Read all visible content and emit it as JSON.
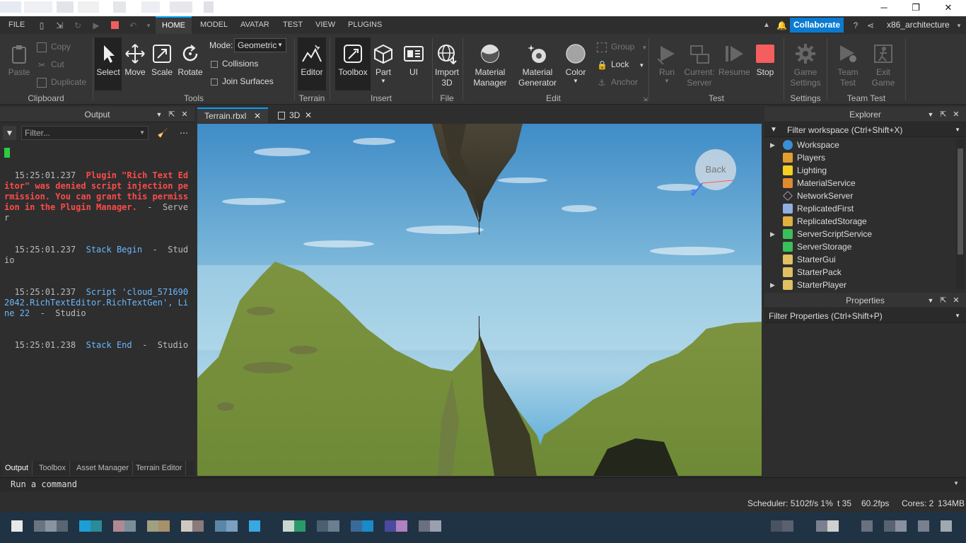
{
  "window": {
    "controls": {
      "minimize": "─",
      "maximize": "❐",
      "close": "✕"
    }
  },
  "menubar": {
    "file": "FILE",
    "tabs": [
      "HOME",
      "MODEL",
      "AVATAR",
      "TEST",
      "VIEW",
      "PLUGINS"
    ],
    "active_tab": "HOME",
    "collaborate": "Collaborate",
    "username": "x86_architecture"
  },
  "ribbon": {
    "clipboard": {
      "paste": "Paste",
      "copy": "Copy",
      "cut": "Cut",
      "duplicate": "Duplicate",
      "group": "Clipboard"
    },
    "tools": {
      "select": "Select",
      "move": "Move",
      "scale": "Scale",
      "rotate": "Rotate",
      "mode_label": "Mode:",
      "mode_value": "Geometric",
      "collisions": "Collisions",
      "join_surfaces": "Join Surfaces",
      "group": "Tools"
    },
    "terrain": {
      "editor": "Editor",
      "group": "Terrain"
    },
    "insert": {
      "toolbox": "Toolbox",
      "part": "Part",
      "ui": "UI",
      "group": "Insert"
    },
    "file": {
      "import3d_1": "Import",
      "import3d_2": "3D",
      "group": "File"
    },
    "edit": {
      "material_manager_1": "Material",
      "material_manager_2": "Manager",
      "material_generator_1": "Material",
      "material_generator_2": "Generator",
      "color": "Color",
      "group_btn": "Group",
      "lock": "Lock",
      "anchor": "Anchor",
      "group": "Edit"
    },
    "test": {
      "run": "Run",
      "current_server_1": "Current:",
      "current_server_2": "Server",
      "resume": "Resume",
      "stop": "Stop",
      "group": "Test"
    },
    "settings": {
      "game_settings_1": "Game",
      "game_settings_2": "Settings",
      "group": "Settings"
    },
    "team_test": {
      "team_test_1": "Team",
      "team_test_2": "Test",
      "exit_game_1": "Exit",
      "exit_game_2": "Game",
      "group": "Team Test"
    }
  },
  "output": {
    "title": "Output",
    "filter_placeholder": "Filter...",
    "log": [
      {
        "time": "15:25:01.237",
        "msg": "Plugin \"Rich Text Editor\" was denied script injection permission. You can grant this permission in the Plugin Manager.",
        "suffix": "  -  Server"
      },
      {
        "time": "15:25:01.237",
        "msg": "Stack Begin",
        "suffix": "  -  Studio"
      },
      {
        "time": "15:25:01.237",
        "msg": "Script 'cloud_5716902042.RichTextEditor.RichTextGen', Line 22",
        "suffix": "  -  Studio"
      },
      {
        "time": "15:25:01.238",
        "msg": "Stack End",
        "suffix": "  -  Studio"
      }
    ],
    "bottom_tabs": [
      "Output",
      "Toolbox",
      "Asset Manager",
      "Terrain Editor"
    ]
  },
  "documents": {
    "tabs": [
      "Terrain.rbxl",
      "3D"
    ],
    "viewcube_label": "Back"
  },
  "explorer": {
    "title": "Explorer",
    "filter": "Filter workspace (Ctrl+Shift+X)",
    "items": [
      {
        "label": "Workspace",
        "expandable": true,
        "icon": "globe-icon"
      },
      {
        "label": "Players",
        "expandable": false,
        "icon": "players-icon"
      },
      {
        "label": "Lighting",
        "expandable": false,
        "icon": "bulb-icon"
      },
      {
        "label": "MaterialService",
        "expandable": false,
        "icon": "material-icon"
      },
      {
        "label": "NetworkServer",
        "expandable": false,
        "icon": "network-icon"
      },
      {
        "label": "ReplicatedFirst",
        "expandable": false,
        "icon": "replicated-first-icon"
      },
      {
        "label": "ReplicatedStorage",
        "expandable": false,
        "icon": "replicated-storage-icon"
      },
      {
        "label": "ServerScriptService",
        "expandable": true,
        "icon": "server-script-icon"
      },
      {
        "label": "ServerStorage",
        "expandable": false,
        "icon": "server-storage-icon"
      },
      {
        "label": "StarterGui",
        "expandable": false,
        "icon": "starter-gui-icon"
      },
      {
        "label": "StarterPack",
        "expandable": false,
        "icon": "starter-pack-icon"
      },
      {
        "label": "StarterPlayer",
        "expandable": true,
        "icon": "starter-player-icon"
      }
    ]
  },
  "properties": {
    "title": "Properties",
    "filter": "Filter Properties (Ctrl+Shift+P)"
  },
  "command": {
    "placeholder": "Run a command"
  },
  "status": {
    "scheduler": "Scheduler: 5102f/s 1%",
    "t": "t 35",
    "fps": "60.2fps",
    "cores": "Cores: 2",
    "mem": "134MB"
  }
}
